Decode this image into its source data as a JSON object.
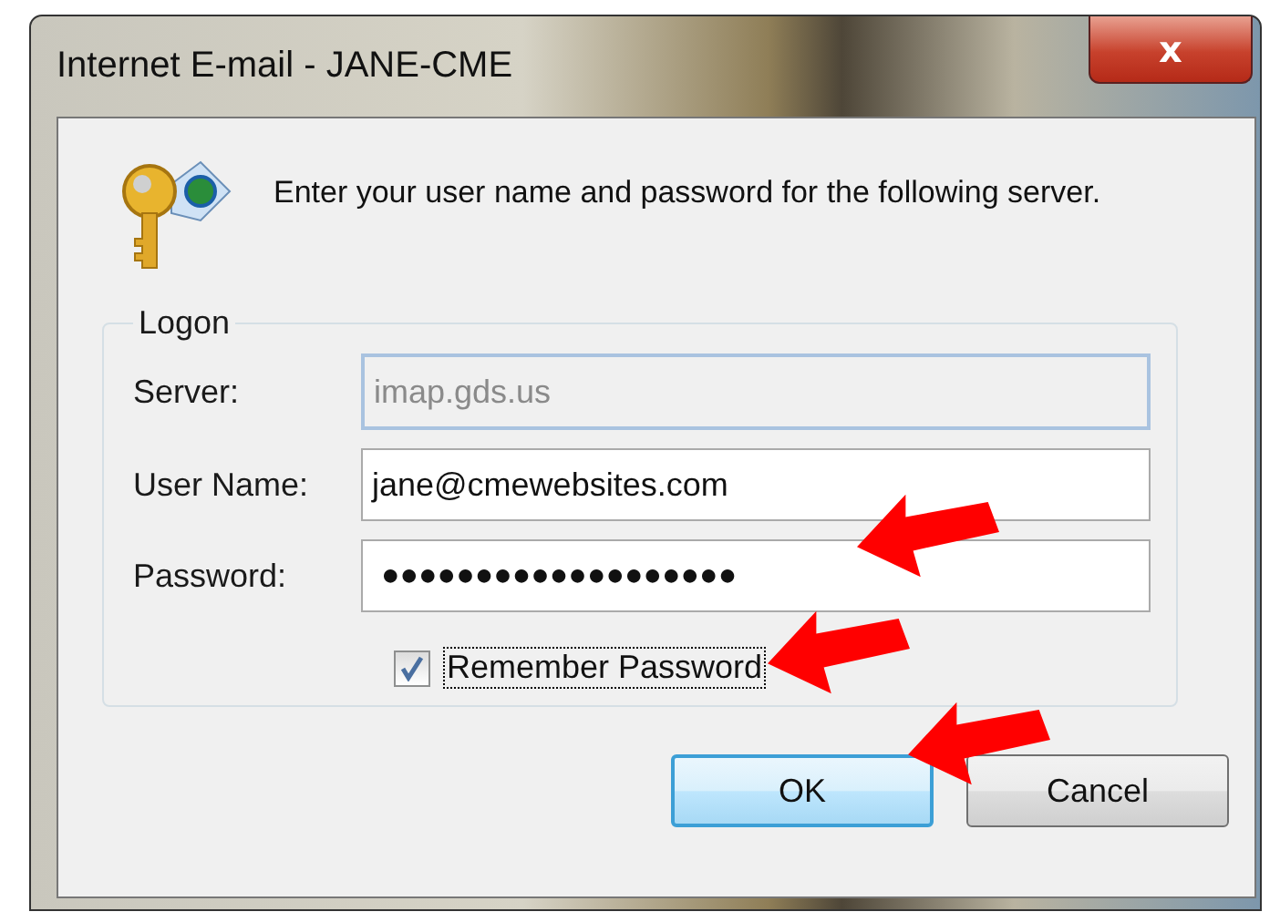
{
  "window": {
    "title": "Internet E-mail - JANE-CME",
    "close": "x"
  },
  "prompt": "Enter your user name and password for the following server.",
  "logon": {
    "legend": "Logon",
    "fields": [
      {
        "label": "Server:",
        "value": "imap.gds.us",
        "disabled": true,
        "highlighted": false
      },
      {
        "label": "User Name:",
        "value": "jane@cmewebsites.com",
        "disabled": false,
        "highlighted": false
      },
      {
        "label": "Password:",
        "value": "●●●●●●●●●●●●●●●●●●●",
        "disabled": false,
        "highlighted": true
      }
    ],
    "remember": {
      "label": "Remember Password",
      "checked": true,
      "highlighted": true
    }
  },
  "buttons": [
    {
      "label": "OK",
      "default": true,
      "highlighted": true
    },
    {
      "label": "Cancel",
      "default": false,
      "highlighted": false
    }
  ]
}
